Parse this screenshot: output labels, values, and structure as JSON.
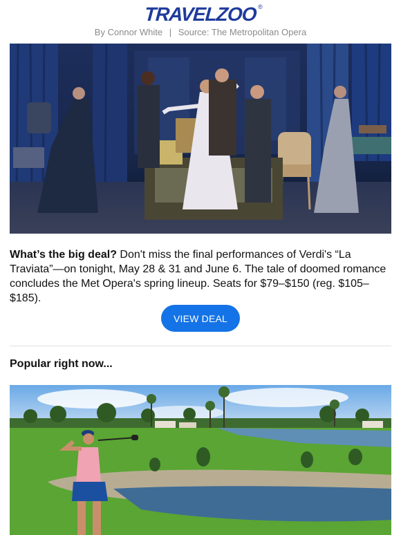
{
  "header": {
    "logo_text": "TRAVELZOO",
    "logo_reg_mark": "®",
    "author": "By Connor White",
    "separator": "|",
    "source": "Source: The Metropolitan Opera"
  },
  "deal": {
    "lead": "What’s the big deal?",
    "body": " Don't miss the final performances of Verdi's “La Traviata”—on tonight, May 28 & 31 and June 6. The tale of doomed romance concludes the Met Opera's spring lineup. Seats for $79–$150 (reg. $105–$185).",
    "cta_label": "VIEW DEAL"
  },
  "popular": {
    "title": "Popular right now..."
  },
  "colors": {
    "brand_blue": "#1f3b9c",
    "cta_blue": "#1473e6",
    "byline_gray": "#8a8a8a"
  }
}
